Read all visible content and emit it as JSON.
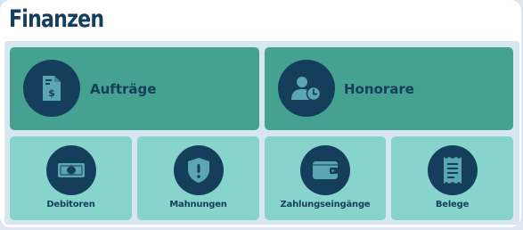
{
  "section": {
    "title": "Finanzen"
  },
  "tiles_large": [
    {
      "label": "Aufträge",
      "icon": "invoice-dollar-icon"
    },
    {
      "label": "Honorare",
      "icon": "user-clock-icon"
    }
  ],
  "tiles_small": [
    {
      "label": "Debitoren",
      "icon": "banknote-icon"
    },
    {
      "label": "Mahnungen",
      "icon": "shield-alert-icon"
    },
    {
      "label": "Zahlungseingänge",
      "icon": "wallet-icon"
    },
    {
      "label": "Belege",
      "icon": "receipt-icon"
    }
  ],
  "colors": {
    "dark_navy": "#153e5c",
    "dark_teal": "#45a190",
    "light_teal": "#86d4cb",
    "icon_light": "#5aa6b6"
  }
}
